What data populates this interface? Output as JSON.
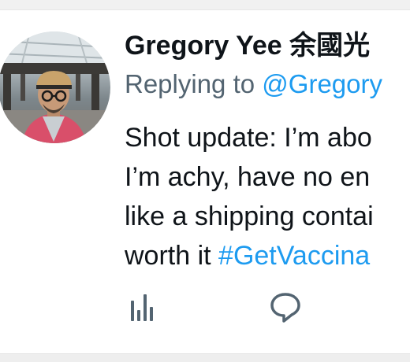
{
  "author": {
    "name": "Gregory Yee",
    "name_cjk": "余國光"
  },
  "reply": {
    "prefix": "Replying to",
    "handle": "@Gregory"
  },
  "tweet": {
    "lines": [
      "Shot update: I’m abo",
      "I’m achy, have no en",
      "like a shipping contai",
      "worth it"
    ],
    "hashtag": "#GetVaccina"
  },
  "actions": [
    {
      "icon": "analytics-icon"
    },
    {
      "icon": "reply-icon"
    }
  ],
  "colors": {
    "link": "#1d9bf0",
    "secondary": "#536471",
    "text": "#0f1419",
    "icon": "#536471"
  }
}
